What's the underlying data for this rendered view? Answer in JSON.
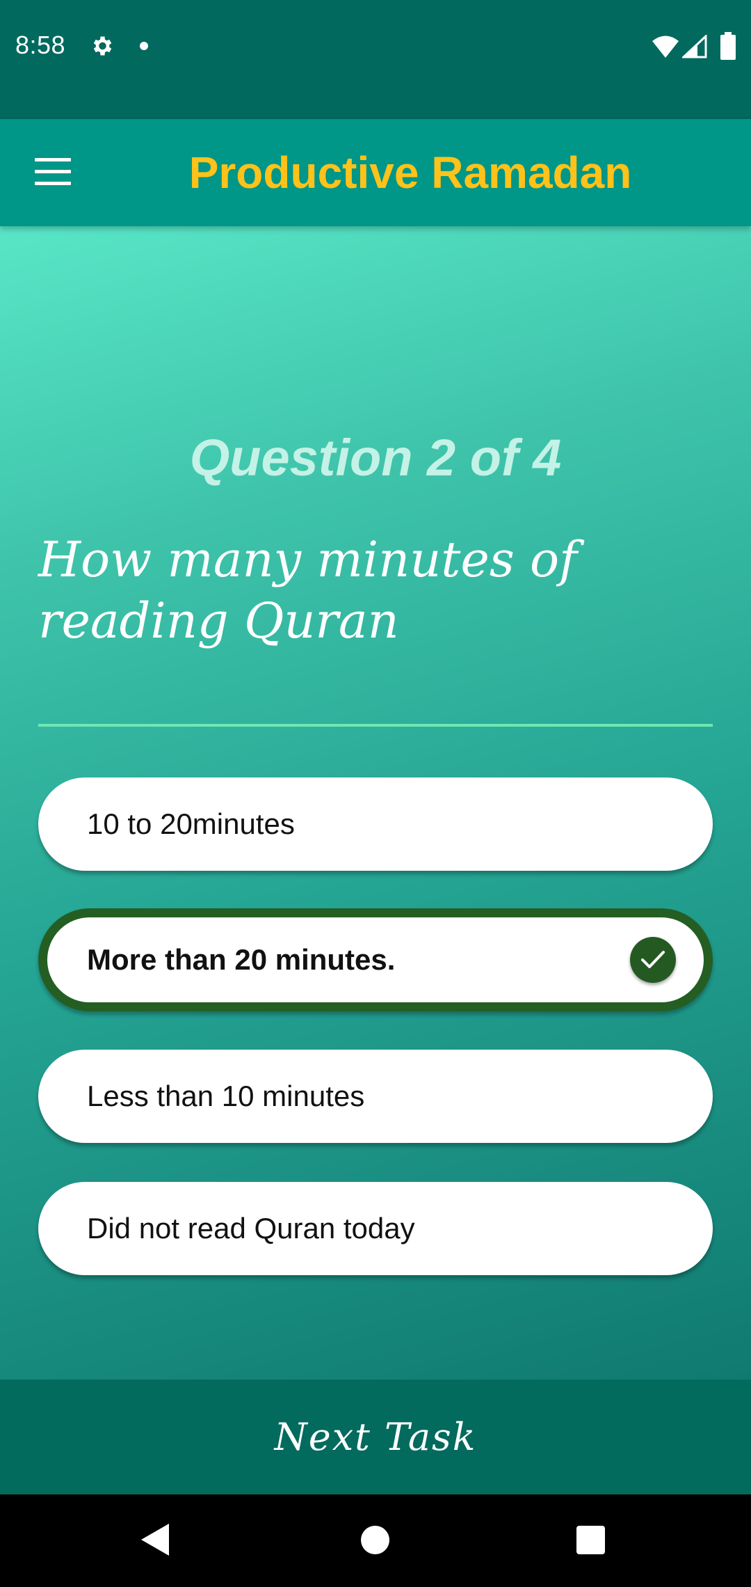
{
  "status_bar": {
    "time": "8:58",
    "icons": [
      "gear-icon",
      "notification-dot-icon",
      "wifi-icon",
      "signal-icon",
      "battery-icon"
    ]
  },
  "app_bar": {
    "title": "Productive Ramadan",
    "menu_icon": "hamburger-menu-icon",
    "title_color": "#ffc21a",
    "background": "#009688"
  },
  "quiz": {
    "counter": "Question 2 of 4",
    "question": "How many minutes of reading Quran",
    "options": [
      {
        "label": "10 to 20minutes",
        "selected": false
      },
      {
        "label": "More than 20 minutes.",
        "selected": true
      },
      {
        "label": "Less than 10 minutes",
        "selected": false
      },
      {
        "label": "Did not read Quran today",
        "selected": false
      }
    ],
    "selected_color": "#255e23"
  },
  "footer": {
    "next_label": "Next Task",
    "background": "#036a5e"
  },
  "nav_bar": {
    "icons": [
      "back-icon",
      "home-icon",
      "recents-icon"
    ]
  }
}
